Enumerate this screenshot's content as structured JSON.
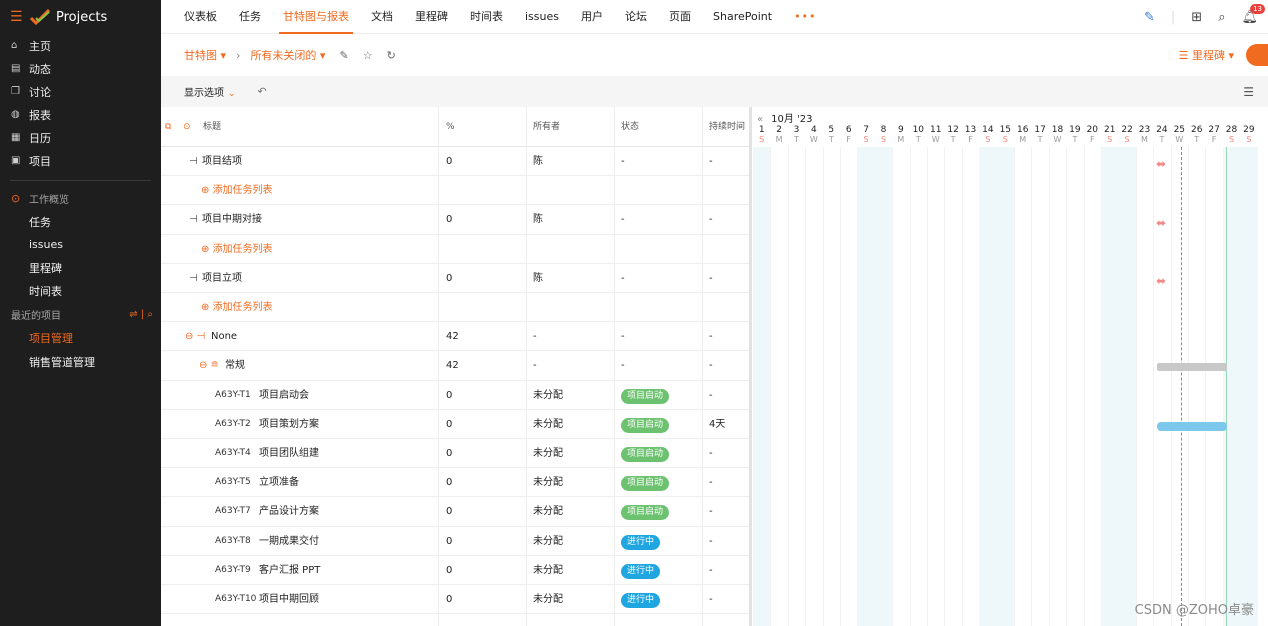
{
  "app": {
    "name": "Projects"
  },
  "sidebar": {
    "items": [
      {
        "label": "主页",
        "icon": "home-icon",
        "glyph": "⌂"
      },
      {
        "label": "动态",
        "icon": "feed-icon",
        "glyph": "▤"
      },
      {
        "label": "讨论",
        "icon": "discussion-icon",
        "glyph": "❐"
      },
      {
        "label": "报表",
        "icon": "reports-icon",
        "glyph": "◍"
      },
      {
        "label": "日历",
        "icon": "calendar-icon",
        "glyph": "▦"
      },
      {
        "label": "项目",
        "icon": "projects-icon",
        "glyph": "▣"
      }
    ],
    "section": "工作概览",
    "sub_items": [
      "任务",
      "issues",
      "里程碑",
      "时间表"
    ],
    "recent_label": "最近的项目",
    "recent_projects": [
      {
        "label": "项目管理",
        "active": true
      },
      {
        "label": "销售管道管理",
        "active": false
      }
    ]
  },
  "topnav": {
    "tabs": [
      {
        "label": "仪表板",
        "active": false
      },
      {
        "label": "任务",
        "active": false
      },
      {
        "label": "甘特图与报表",
        "active": true
      },
      {
        "label": "文档",
        "active": false
      },
      {
        "label": "里程碑",
        "active": false
      },
      {
        "label": "时间表",
        "active": false
      },
      {
        "label": "issues",
        "active": false
      },
      {
        "label": "用户",
        "active": false
      },
      {
        "label": "论坛",
        "active": false
      },
      {
        "label": "页面",
        "active": false
      },
      {
        "label": "SharePoint",
        "active": false
      }
    ],
    "more": "•••",
    "notifications": "13"
  },
  "toolbar": {
    "view": "甘特图",
    "filter": "所有未关闭的",
    "milestone_btn": "里程碑"
  },
  "options": {
    "label": "显示选项"
  },
  "grid": {
    "headers": {
      "title": "标题",
      "percent": "%",
      "owner": "所有者",
      "status": "状态",
      "duration": "持续时间"
    },
    "rows": [
      {
        "kind": "milestone",
        "title": "项目结项",
        "percent": "0",
        "owner": "陈",
        "status": "-",
        "duration": "-"
      },
      {
        "kind": "add",
        "title": "添加任务列表"
      },
      {
        "kind": "milestone",
        "title": "项目中期对接",
        "percent": "0",
        "owner": "陈",
        "status": "-",
        "duration": "-"
      },
      {
        "kind": "add",
        "title": "添加任务列表"
      },
      {
        "kind": "milestone",
        "title": "项目立项",
        "percent": "0",
        "owner": "陈",
        "status": "-",
        "duration": "-"
      },
      {
        "kind": "add",
        "title": "添加任务列表"
      },
      {
        "kind": "group",
        "title": "None",
        "percent": "42",
        "owner": "-",
        "status": "-",
        "duration": "-"
      },
      {
        "kind": "list",
        "title": "常规",
        "percent": "42",
        "owner": "-",
        "status": "-",
        "duration": "-"
      },
      {
        "kind": "task",
        "id": "A63Y-T1",
        "title": "项目启动会",
        "percent": "0",
        "owner": "未分配",
        "status": "项目启动",
        "status_color": "#6cc26f",
        "duration": "-"
      },
      {
        "kind": "task",
        "id": "A63Y-T2",
        "title": "项目策划方案",
        "percent": "0",
        "owner": "未分配",
        "status": "项目启动",
        "status_color": "#6cc26f",
        "duration": "4天"
      },
      {
        "kind": "task",
        "id": "A63Y-T4",
        "title": "项目团队组建",
        "percent": "0",
        "owner": "未分配",
        "status": "项目启动",
        "status_color": "#6cc26f",
        "duration": "-"
      },
      {
        "kind": "task",
        "id": "A63Y-T5",
        "title": "立项准备",
        "percent": "0",
        "owner": "未分配",
        "status": "项目启动",
        "status_color": "#6cc26f",
        "duration": "-"
      },
      {
        "kind": "task",
        "id": "A63Y-T7",
        "title": "产品设计方案",
        "percent": "0",
        "owner": "未分配",
        "status": "项目启动",
        "status_color": "#6cc26f",
        "duration": "-"
      },
      {
        "kind": "task",
        "id": "A63Y-T8",
        "title": "一期成果交付",
        "percent": "0",
        "owner": "未分配",
        "status": "进行中",
        "status_color": "#1fa6e0",
        "duration": "-"
      },
      {
        "kind": "task",
        "id": "A63Y-T9",
        "title": "客户汇报 PPT",
        "percent": "0",
        "owner": "未分配",
        "status": "进行中",
        "status_color": "#1fa6e0",
        "duration": "-"
      },
      {
        "kind": "task",
        "id": "A63Y-T10",
        "title": "项目中期回顾",
        "percent": "0",
        "owner": "未分配",
        "status": "进行中",
        "status_color": "#1fa6e0",
        "duration": "-"
      }
    ]
  },
  "gantt": {
    "month": "10月 '23",
    "days": [
      "1",
      "2",
      "3",
      "4",
      "5",
      "6",
      "7",
      "8",
      "9",
      "10",
      "11",
      "12",
      "13",
      "14",
      "15",
      "16",
      "17",
      "18",
      "19",
      "20",
      "21",
      "22",
      "23",
      "24",
      "25",
      "26",
      "27",
      "28",
      "29"
    ],
    "dows": [
      "S",
      "M",
      "T",
      "W",
      "T",
      "F",
      "S",
      "S",
      "M",
      "T",
      "W",
      "T",
      "F",
      "S",
      "S",
      "M",
      "T",
      "W",
      "T",
      "F",
      "S",
      "S",
      "M",
      "T",
      "W",
      "T",
      "F",
      "S",
      "S"
    ]
  },
  "watermark": "CSDN @ZOHO卓豪"
}
